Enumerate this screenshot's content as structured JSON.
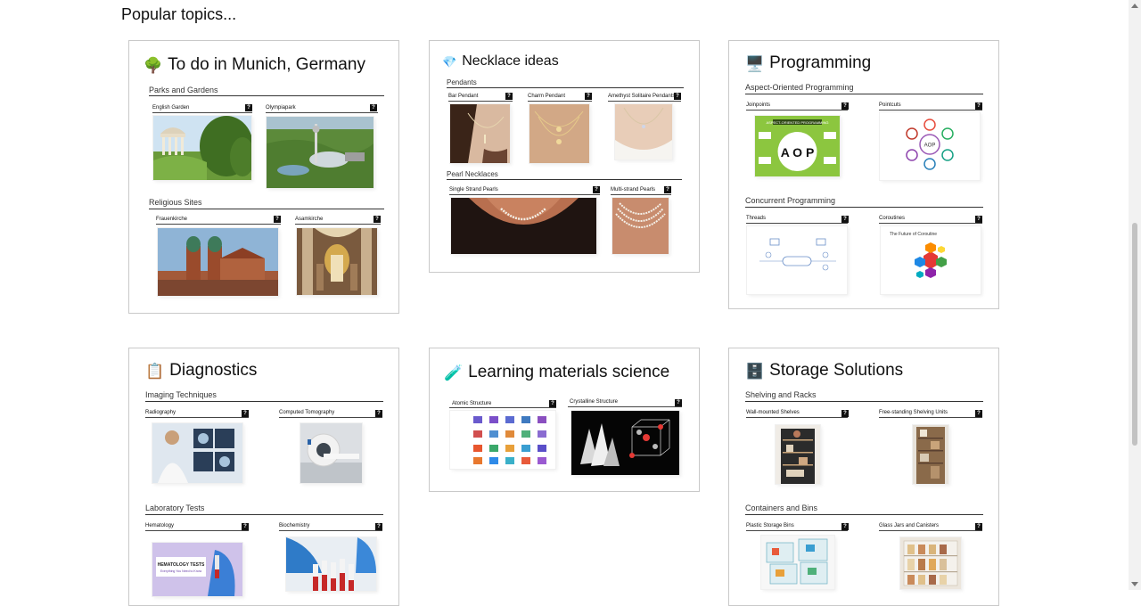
{
  "heading": "Popular topics...",
  "cards": {
    "munich": {
      "title": "To do in Munich, Germany",
      "icon": "tree-icon",
      "sections": [
        {
          "label": "Parks and Gardens",
          "items": [
            "English Garden",
            "Olympiapark"
          ]
        },
        {
          "label": "Religious Sites",
          "items": [
            "Frauenkirche",
            "Asamkirche"
          ]
        }
      ]
    },
    "necklace": {
      "title": "Necklace ideas",
      "icon": "gem-icon",
      "sections": [
        {
          "label": "Pendants",
          "items": [
            "Bar Pendant",
            "Charm Pendant",
            "Amethyst Solitaire Pendants"
          ]
        },
        {
          "label": "Pearl Necklaces",
          "items": [
            "Single Strand Pearls",
            "Multi-strand Pearls"
          ]
        }
      ]
    },
    "programming": {
      "title": "Programming",
      "icon": "computer-icon",
      "sections": [
        {
          "label": "Aspect-Oriented Programming",
          "items": [
            "Joinpoints",
            "Pointcuts"
          ]
        },
        {
          "label": "Concurrent Programming",
          "items": [
            "Threads",
            "Coroutines"
          ]
        }
      ],
      "image_text": {
        "aop_header": "ASPECT-ORIENTED PROGRAMMING",
        "aop_big": "A O P",
        "pointcut_center": "AOP",
        "coroutine_title": "The Future of Coroutine"
      }
    },
    "diagnostics": {
      "title": "Diagnostics",
      "icon": "clipboard-icon",
      "sections": [
        {
          "label": "Imaging Techniques",
          "items": [
            "Radiography",
            "Computed Tomography"
          ]
        },
        {
          "label": "Laboratory Tests",
          "items": [
            "Hematology",
            "Biochemistry"
          ]
        }
      ],
      "image_text": {
        "hematology_banner": "HEMATOLOGY TESTS",
        "hematology_sub": "Everything You Need to Know"
      }
    },
    "materials": {
      "title": "Learning materials science",
      "icon": "test-tube-icon",
      "sections": [
        {
          "label": "",
          "items": [
            "Atomic Structure",
            "Crystalline Structure"
          ]
        }
      ]
    },
    "storage": {
      "title": "Storage Solutions",
      "icon": "shelves-icon",
      "sections": [
        {
          "label": "Shelving and Racks",
          "items": [
            "Wall-mounted Shelves",
            "Free-standing Shelving Units"
          ]
        },
        {
          "label": "Containers and Bins",
          "items": [
            "Plastic Storage Bins",
            "Glass Jars and Canisters"
          ]
        }
      ]
    }
  },
  "help_glyph": "?",
  "colors": {
    "card_border": "#c9c9c9",
    "aop_green": "#8cc63f",
    "ct_blue": "#2a62a8"
  }
}
